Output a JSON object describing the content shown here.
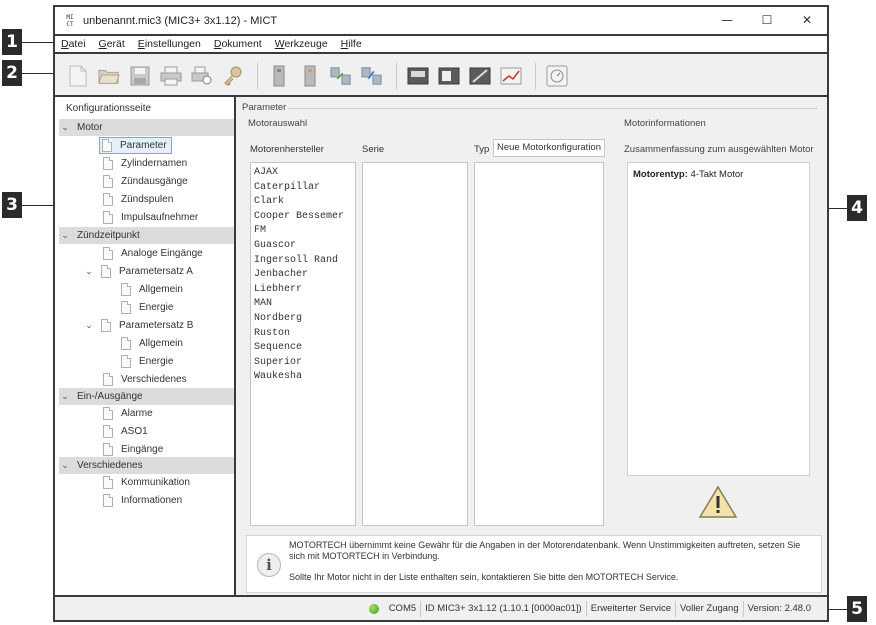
{
  "callouts": [
    "1",
    "2",
    "3",
    "4",
    "5"
  ],
  "window": {
    "app_icon": "MI CT",
    "title": "unbenannt.mic3 (MIC3+ 3x1.12) - MICT",
    "controls": {
      "minimize": "—",
      "maximize": "☐",
      "close": "✕"
    }
  },
  "menu": [
    {
      "label": "Datei"
    },
    {
      "label": "Gerät"
    },
    {
      "label": "Einstellungen"
    },
    {
      "label": "Dokument"
    },
    {
      "label": "Werkzeuge"
    },
    {
      "label": "Hilfe"
    }
  ],
  "toolbar": {
    "icons": [
      "new-file-icon",
      "open-folder-icon",
      "save-icon",
      "print-icon",
      "print-preview-icon",
      "key-icon",
      "device-disconnect-icon",
      "device-connect-icon",
      "transfer-upload-icon",
      "transfer-download-icon",
      "monitor-icon",
      "window-icon",
      "diagonal-view-icon",
      "chart-icon",
      "gauge-icon"
    ]
  },
  "tree": {
    "title": "Konfigurationsseite",
    "groups": {
      "motor": "Motor",
      "zuendzeitpunkt": "Zündzeitpunkt",
      "ein_ausgaenge": "Ein-/Ausgänge",
      "verschiedenes": "Verschiedenes"
    },
    "items": {
      "parameter": "Parameter",
      "zylindernamen": "Zylindernamen",
      "zuendausgaenge": "Zündausgänge",
      "zuendspulen": "Zündspulen",
      "impulsaufnehmer": "Impulsaufnehmer",
      "analoge_eingaenge": "Analoge Eingänge",
      "parametersatz_a": "Parametersatz A",
      "allgemein_a": "Allgemein",
      "energie_a": "Energie",
      "parametersatz_b": "Parametersatz B",
      "allgemein_b": "Allgemein",
      "energie_b": "Energie",
      "verschiedenes_item": "Verschiedenes",
      "alarme": "Alarme",
      "aso1": "ASO1",
      "eingaenge": "Eingänge",
      "kommunikation": "Kommunikation",
      "informationen": "Informationen"
    }
  },
  "parameter": {
    "section_title": "Parameter",
    "motorauswahl": {
      "title": "Motorauswahl",
      "col_hersteller": "Motorenhersteller",
      "col_serie": "Serie",
      "col_typ": "Typ",
      "new_config_button": "Neue Motorkonfiguration",
      "manufacturers": [
        "AJAX",
        "Caterpillar",
        "Clark",
        "Cooper Bessemer",
        "FM",
        "Guascor",
        "Ingersoll Rand",
        "Jenbacher",
        "Liebherr",
        "MAN",
        "Nordberg",
        "Ruston",
        "Sequence",
        "Superior",
        "Waukesha"
      ]
    },
    "motorinfo": {
      "title": "Motorinformationen",
      "summary_label": "Zusammenfassung zum ausgewählten Motor",
      "type_label": "Motorentyp:",
      "type_value": "4-Takt Motor"
    },
    "notice": {
      "line1": "MOTORTECH übernimmt keine Gewähr für die Angaben in der Motorendatenbank. Wenn Unstimmigkeiten auftreten, setzen Sie",
      "line2": "sich mit MOTORTECH in Verbindung.",
      "line3": "Sollte Ihr Motor nicht in der Liste enthalten sein, kontaktieren Sie bitte den MOTORTECH Service."
    }
  },
  "status": {
    "led_color": "#3b9a1c",
    "port": "COM5",
    "device_id": "ID MIC3+ 3x1.12 (1.10.1 [0000ac01])",
    "service": "Erweiterter Service",
    "access": "Voller Zugang",
    "version": "Version: 2.48.0"
  }
}
